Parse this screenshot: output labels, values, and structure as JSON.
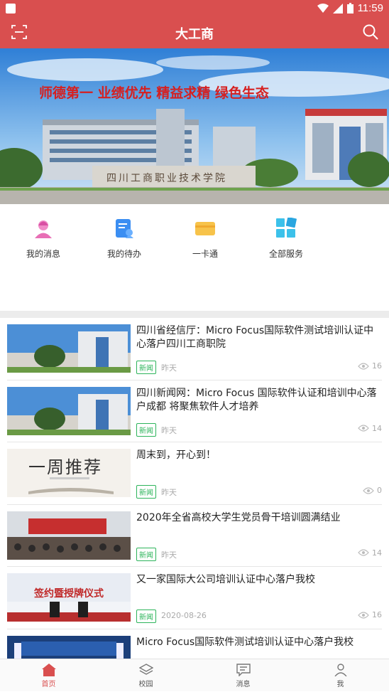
{
  "status": {
    "time": "11:59"
  },
  "header": {
    "title": "大工商"
  },
  "banner": {
    "slogan": "师德第一  业绩优先  精益求精  绿色生态",
    "gate_text": "四川工商职业技术学院"
  },
  "quick_actions": [
    {
      "label": "我的消息",
      "icon": "message-person-icon"
    },
    {
      "label": "我的待办",
      "icon": "todo-doc-icon"
    },
    {
      "label": "一卡通",
      "icon": "card-icon"
    },
    {
      "label": "全部服务",
      "icon": "grid-services-icon"
    }
  ],
  "news": [
    {
      "title": "四川省经信厅：Micro Focus国际软件测试培训认证中心落户四川工商职院",
      "tag": "新闻",
      "date": "昨天",
      "views": "16"
    },
    {
      "title": "四川新闻网：Micro Focus 国际软件认证和培训中心落户成都 将聚焦软件人才培养",
      "tag": "新闻",
      "date": "昨天",
      "views": "14"
    },
    {
      "title": "周末到，开心到！",
      "tag": "新闻",
      "date": "昨天",
      "views": "0",
      "thumb_text": "一周推荐"
    },
    {
      "title": "2020年全省高校大学生党员骨干培训圆满结业",
      "tag": "新闻",
      "date": "昨天",
      "views": "14"
    },
    {
      "title": "又一家国际大公司培训认证中心落户我校",
      "tag": "新闻",
      "date": "2020-08-26",
      "views": "16",
      "thumb_text": "签约暨授牌仪式"
    },
    {
      "title": "Micro Focus国际软件测试培训认证中心落户我校",
      "tag": "",
      "date": "",
      "views": ""
    }
  ],
  "tabbar": [
    {
      "label": "首页",
      "active": true
    },
    {
      "label": "校园",
      "active": false
    },
    {
      "label": "消息",
      "active": false
    },
    {
      "label": "我",
      "active": false
    }
  ],
  "colors": {
    "primary": "#d94f4f",
    "tag_green": "#2db45b"
  }
}
